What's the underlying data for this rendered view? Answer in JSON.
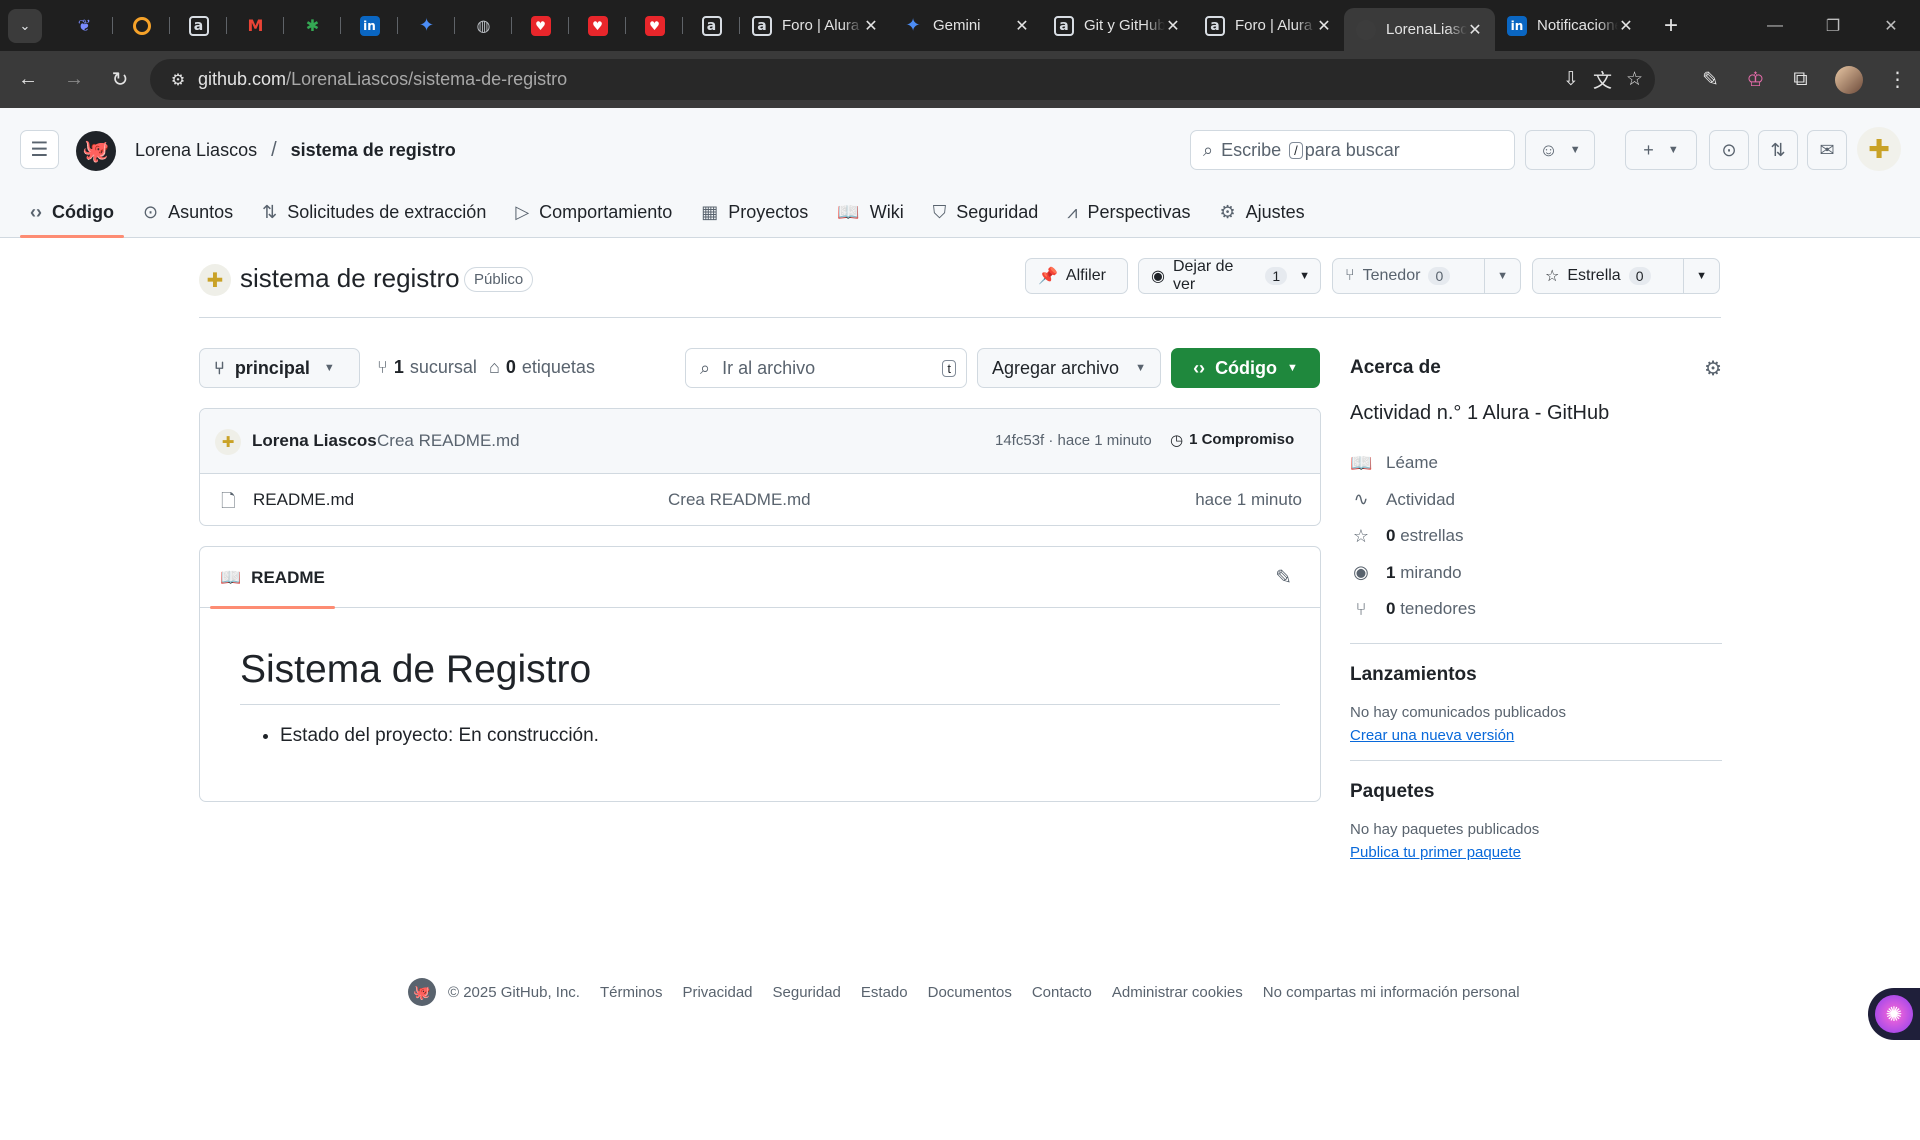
{
  "browser": {
    "pinned_tabs": [
      {
        "icon": "blue-swirl-icon"
      },
      {
        "icon": "orange-ring-icon"
      },
      {
        "icon": "alura-icon"
      },
      {
        "icon": "gmail-icon"
      },
      {
        "icon": "multicolor-asterisk-icon"
      },
      {
        "icon": "linkedin-icon"
      },
      {
        "icon": "gemini-icon"
      },
      {
        "icon": "globe-icon"
      },
      {
        "icon": "red-heart-icon"
      },
      {
        "icon": "red-heart-icon"
      },
      {
        "icon": "red-heart-icon"
      },
      {
        "icon": "alura-icon"
      }
    ],
    "tabs": [
      {
        "label": "Foro | Alura",
        "icon": "alura-icon",
        "active": false
      },
      {
        "label": "Gemini",
        "icon": "gemini-icon",
        "active": false
      },
      {
        "label": "Git y GitHub",
        "icon": "alura-icon",
        "active": false
      },
      {
        "label": "Foro | Alura",
        "icon": "alura-icon",
        "active": false
      },
      {
        "label": "LorenaLiascos",
        "icon": "github-icon",
        "active": true
      },
      {
        "label": "Notificaciones",
        "icon": "linkedin-icon",
        "active": false
      }
    ],
    "url_domain": "github.com",
    "url_path": "/LorenaLiascos/sistema-de-registro"
  },
  "header": {
    "owner": "Lorena Liascos",
    "separator": "/",
    "repo": "sistema de registro",
    "search_pre": "Escribe",
    "search_key": "/",
    "search_post": "para buscar"
  },
  "repo_nav": [
    {
      "label": "Código",
      "icon": "code-icon",
      "selected": true
    },
    {
      "label": "Asuntos",
      "icon": "issue-icon",
      "selected": false
    },
    {
      "label": "Solicitudes de extracción",
      "icon": "pull-request-icon",
      "selected": false
    },
    {
      "label": "Comportamiento",
      "icon": "play-icon",
      "selected": false
    },
    {
      "label": "Proyectos",
      "icon": "table-icon",
      "selected": false
    },
    {
      "label": "Wiki",
      "icon": "book-icon",
      "selected": false
    },
    {
      "label": "Seguridad",
      "icon": "shield-icon",
      "selected": false
    },
    {
      "label": "Perspectivas",
      "icon": "graph-icon",
      "selected": false
    },
    {
      "label": "Ajustes",
      "icon": "gear-icon",
      "selected": false
    }
  ],
  "title": {
    "name": "sistema de registro",
    "visibility": "Público",
    "pin": "Alfiler",
    "watch": "Dejar de ver",
    "watch_count": "1",
    "fork": "Tenedor",
    "fork_count": "0",
    "star": "Estrella",
    "star_count": "0"
  },
  "file_toolbar": {
    "branch": "principal",
    "branches_count": "1",
    "branches_label": "sucursal",
    "tags_count": "0",
    "tags_label": "etiquetas",
    "goto_placeholder": "Ir al archivo",
    "goto_key": "t",
    "add_file": "Agregar archivo",
    "code": "Código"
  },
  "commit": {
    "author": "Lorena Liascos",
    "message": "Crea README.md",
    "meta": "14fc53f · hace 1 minuto",
    "history": "1 Compromiso"
  },
  "files": [
    {
      "name": "README.md",
      "message": "Crea README.md",
      "date": "hace 1 minuto"
    }
  ],
  "readme": {
    "tab": "README",
    "heading": "Sistema de Registro",
    "items": [
      "Estado del proyecto: En construcción."
    ]
  },
  "sidebar": {
    "about_title": "Acerca de",
    "description": "Actividad n.° 1 Alura - GitHub",
    "links": [
      {
        "icon": "book-icon",
        "count": "",
        "label": "Léame"
      },
      {
        "icon": "pulse-icon",
        "count": "",
        "label": "Actividad"
      },
      {
        "icon": "star-icon",
        "count": "0",
        "label": "estrellas"
      },
      {
        "icon": "eye-icon",
        "count": "1",
        "label": "mirando"
      },
      {
        "icon": "fork-icon",
        "count": "0",
        "label": "tenedores"
      }
    ],
    "releases_title": "Lanzamientos",
    "releases_text": "No hay comunicados publicados",
    "releases_link": "Crear una nueva versión",
    "packages_title": "Paquetes",
    "packages_text": "No hay paquetes publicados",
    "packages_link": "Publica tu primer paquete"
  },
  "footer": {
    "copyright": "© 2025 GitHub, Inc.",
    "links": [
      "Términos",
      "Privacidad",
      "Seguridad",
      "Estado",
      "Documentos",
      "Contacto",
      "Administrar cookies",
      "No compartas mi información personal"
    ]
  },
  "colors": {
    "accent_tab": "#fd8c73",
    "primary_button": "#1f883d",
    "link": "#0969da"
  }
}
